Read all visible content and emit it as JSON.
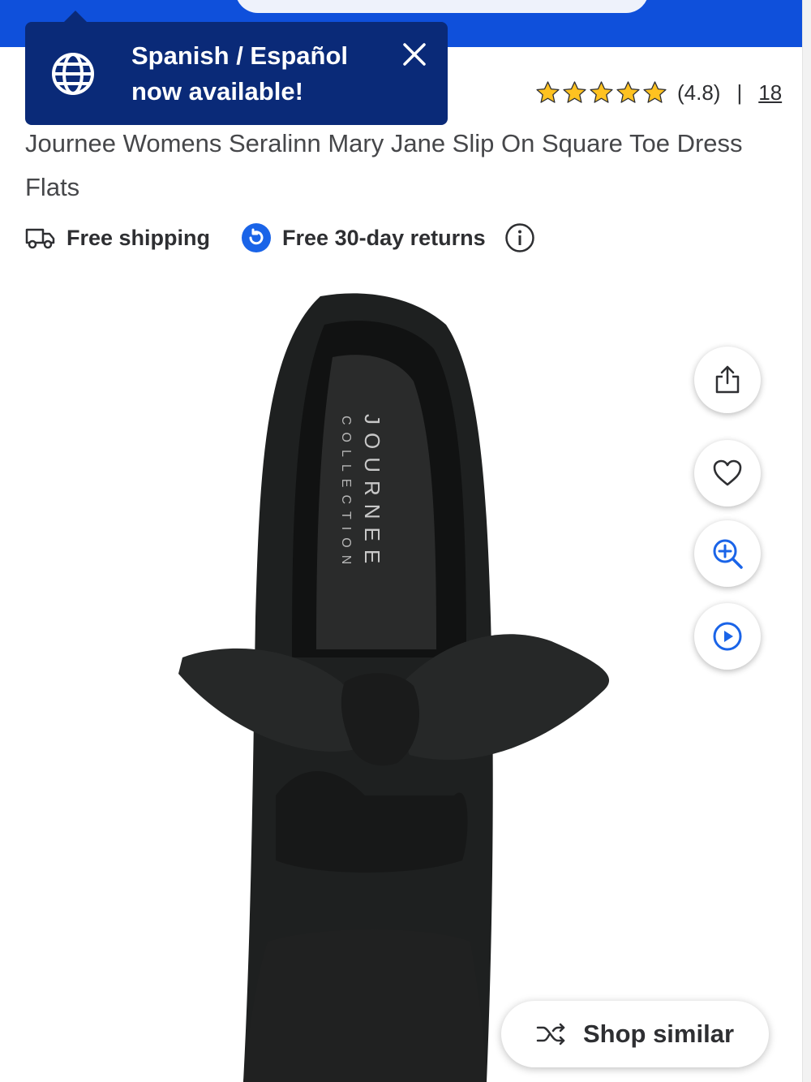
{
  "language_popup": {
    "line1": "Spanish / Español",
    "line2": "now available!",
    "icon": "globe-icon",
    "close_icon": "close-icon"
  },
  "rating": {
    "stars_filled": 5,
    "stars_total": 5,
    "value_text": "(4.8)",
    "separator": "|",
    "review_count": "18",
    "star_color": "#ffc220"
  },
  "product": {
    "title": "Journee Womens Seralinn Mary Jane Slip On Square Toe Dress Flats",
    "image_alt": "Black square toe flat with bow, JOURNEE COLLECTION insole",
    "brand_insole_line1": "JOURNEE",
    "brand_insole_line2": "COLLECTION"
  },
  "badges": {
    "shipping": "Free shipping",
    "returns": "Free 30-day returns",
    "info_icon": "info-icon"
  },
  "actions": {
    "share_icon": "share-icon",
    "favorite_icon": "heart-icon",
    "zoom_icon": "zoom-in-icon",
    "video_icon": "play-icon"
  },
  "shop_similar": {
    "label": "Shop similar",
    "icon": "shuffle-icon"
  },
  "colors": {
    "brand_blue": "#0f50db",
    "popup_navy": "#0a2a78",
    "icon_blue": "#1a64e8"
  }
}
